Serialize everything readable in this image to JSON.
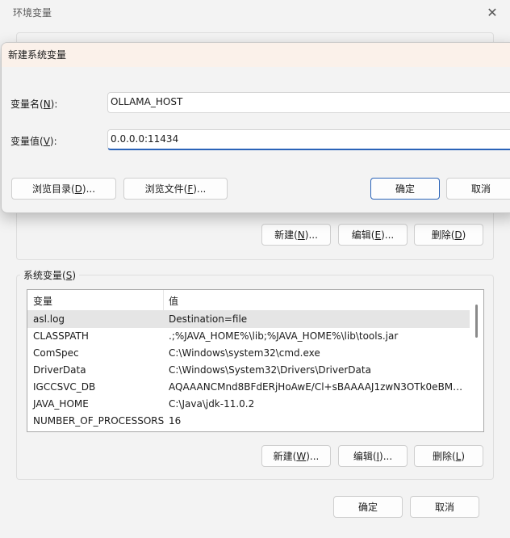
{
  "window": {
    "title": "环境变量",
    "close_glyph": "✕"
  },
  "user_vars": {
    "buttons": {
      "new": "新建(",
      "new_key": "N",
      "new_end": ")...",
      "edit": "编辑(",
      "edit_key": "E",
      "edit_end": ")...",
      "delete": "删除(",
      "delete_key": "D",
      "delete_end": ")"
    }
  },
  "system_vars": {
    "legend": "系统变量(",
    "legend_key": "S",
    "legend_end": ")",
    "columns": {
      "name": "变量",
      "value": "值"
    },
    "rows": [
      {
        "name": "asl.log",
        "value": "Destination=file"
      },
      {
        "name": "CLASSPATH",
        "value": ".;%JAVA_HOME%\\lib;%JAVA_HOME%\\lib\\tools.jar"
      },
      {
        "name": "ComSpec",
        "value": "C:\\Windows\\system32\\cmd.exe"
      },
      {
        "name": "DriverData",
        "value": "C:\\Windows\\System32\\Drivers\\DriverData"
      },
      {
        "name": "IGCCSVC_DB",
        "value": "AQAAANCMnd8BFdERjHoAwE/Cl+sBAAAAJ1zwN3OTk0eBMG..."
      },
      {
        "name": "JAVA_HOME",
        "value": "C:\\Java\\jdk-11.0.2"
      },
      {
        "name": "NUMBER_OF_PROCESSORS",
        "value": "16"
      }
    ],
    "buttons": {
      "new": "新建(",
      "new_key": "W",
      "new_end": ")...",
      "edit": "编辑(",
      "edit_key": "I",
      "edit_end": ")...",
      "delete": "删除(",
      "delete_key": "L",
      "delete_end": ")"
    }
  },
  "footer": {
    "ok": "确定",
    "cancel": "取消"
  },
  "dialog": {
    "title": "新建系统变量",
    "name_label": "变量名(",
    "name_key": "N",
    "name_end": "):",
    "name_value": "OLLAMA_HOST",
    "value_label": "变量值(",
    "value_key": "V",
    "value_end": "):",
    "value_value": "0.0.0.0:11434",
    "browse_dir": "浏览目录(",
    "browse_dir_key": "D",
    "browse_dir_end": ")...",
    "browse_file": "浏览文件(",
    "browse_file_key": "F",
    "browse_file_end": ")...",
    "ok": "确定",
    "cancel": "取消"
  }
}
